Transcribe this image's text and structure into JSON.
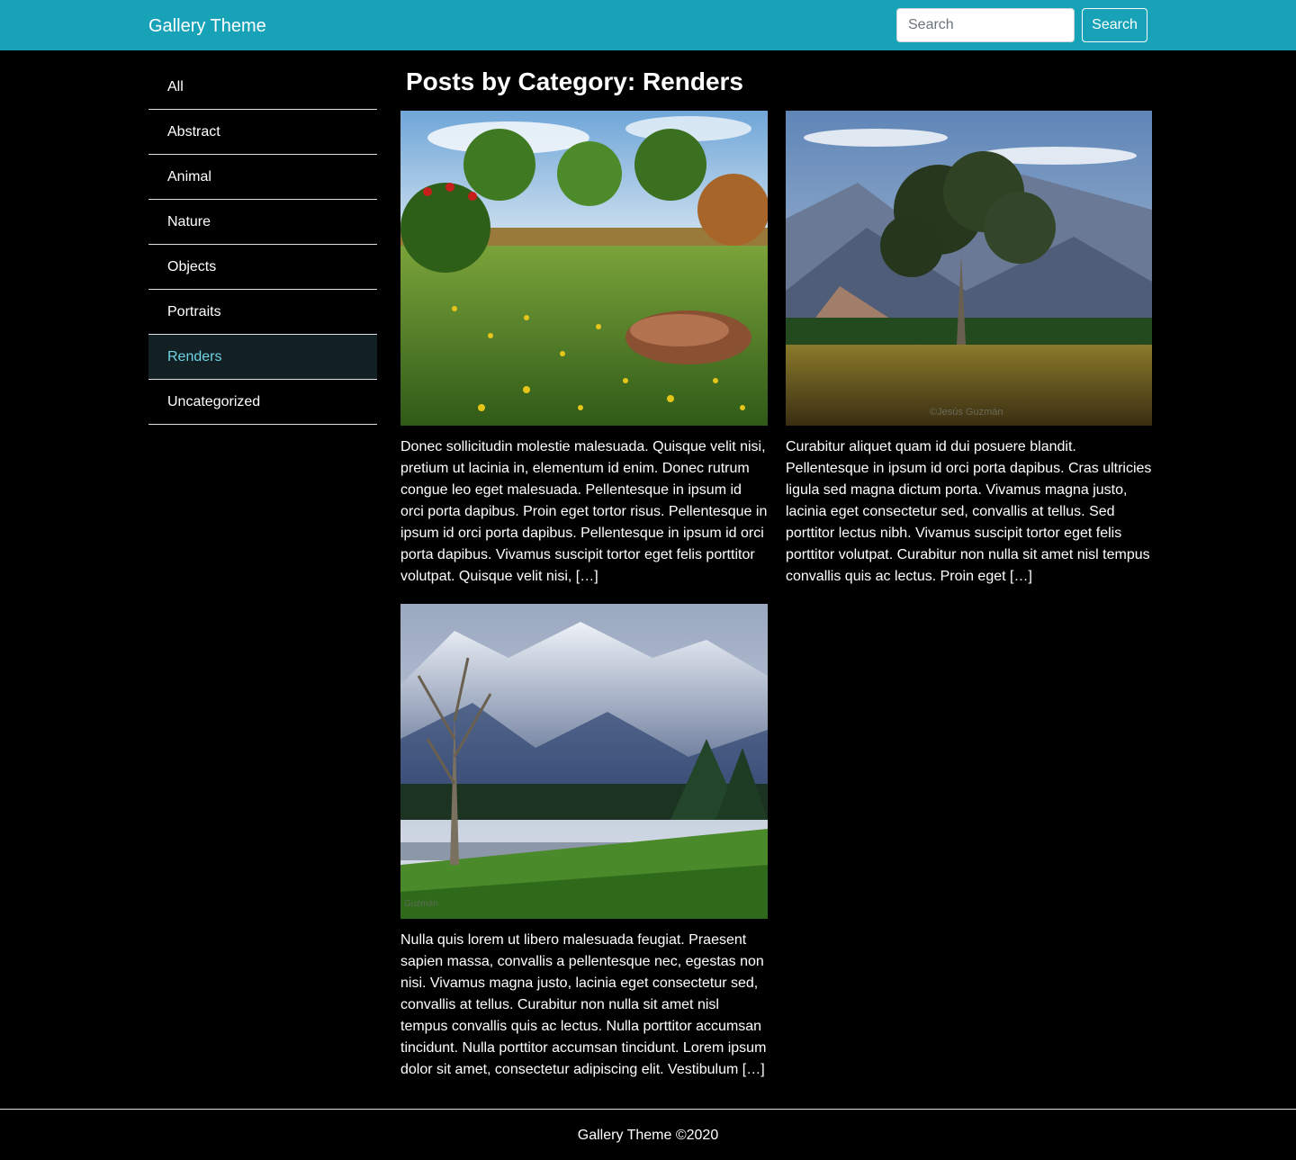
{
  "header": {
    "brand": "Gallery Theme",
    "search_placeholder": "Search",
    "search_button": "Search"
  },
  "sidebar": {
    "items": [
      {
        "label": "All"
      },
      {
        "label": "Abstract"
      },
      {
        "label": "Animal"
      },
      {
        "label": "Nature"
      },
      {
        "label": "Objects"
      },
      {
        "label": "Portraits"
      },
      {
        "label": "Renders",
        "active": true
      },
      {
        "label": "Uncategorized"
      }
    ]
  },
  "main": {
    "title": "Posts by Category: Renders",
    "posts": [
      {
        "image_alt": "meadow-render",
        "excerpt": "Donec sollicitudin molestie malesuada. Quisque velit nisi, pretium ut lacinia in, elementum id enim. Donec rutrum congue leo eget malesuada. Pellentesque in ipsum id orci porta dapibus. Proin eget tortor risus. Pellentesque in ipsum id orci porta dapibus. Pellentesque in ipsum id orci porta dapibus. Vivamus suscipit tortor eget felis porttitor volutpat. Quisque velit nisi, […]"
      },
      {
        "image_alt": "tree-mountain-render",
        "watermark": "©Jesús Guzmán",
        "excerpt": "Curabitur aliquet quam id dui posuere blandit. Pellentesque in ipsum id orci porta dapibus. Cras ultricies ligula sed magna dictum porta. Vivamus magna justo, lacinia eget consectetur sed, convallis at tellus. Sed porttitor lectus nibh. Vivamus suscipit tortor eget felis porttitor volutpat. Curabitur non nulla sit amet nisl tempus convallis quis ac lectus. Proin eget […]"
      },
      {
        "image_alt": "snowy-mountain-render",
        "watermark": "Guzmán",
        "excerpt": "Nulla quis lorem ut libero malesuada feugiat. Praesent sapien massa, convallis a pellentesque nec, egestas non nisi. Vivamus magna justo, lacinia eget consectetur sed, convallis at tellus. Curabitur non nulla sit amet nisl tempus convallis quis ac lectus. Nulla porttitor accumsan tincidunt. Nulla porttitor accumsan tincidunt. Lorem ipsum dolor sit amet, consectetur adipiscing elit. Vestibulum […]"
      }
    ]
  },
  "footer": {
    "text": "Gallery Theme ©2020"
  },
  "colors": {
    "header_bg": "#17a2b8",
    "page_bg": "#000000",
    "active_item_bg": "#122024",
    "active_item_text": "#6fd3e6"
  }
}
